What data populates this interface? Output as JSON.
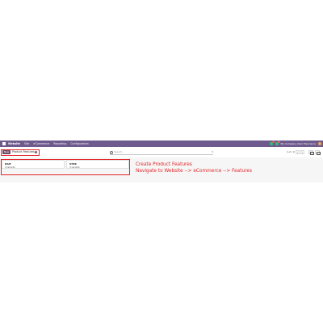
{
  "topbar": {
    "brand": "Website",
    "menu": [
      "Site",
      "eCommerce",
      "Reporting",
      "Configuration"
    ],
    "company": "My Company (San Francisco)",
    "chat_count": "1",
    "activity_count": "1"
  },
  "controlbar": {
    "new_label": "New",
    "breadcrumb": "Product Features",
    "search_placeholder": "Search...",
    "pager": "1-2 / 2"
  },
  "cards": [
    {
      "name": "RAM",
      "count": "4 records"
    },
    {
      "name": "STOR",
      "count": "3 records"
    }
  ],
  "annotation": {
    "title": "Create Product Features",
    "path": "Navigate to Website --> eCommerce --> Features"
  },
  "colors": {
    "topbar": "#6e5a8d",
    "primary": "#714b67",
    "annotation_red": "#e3262b"
  }
}
